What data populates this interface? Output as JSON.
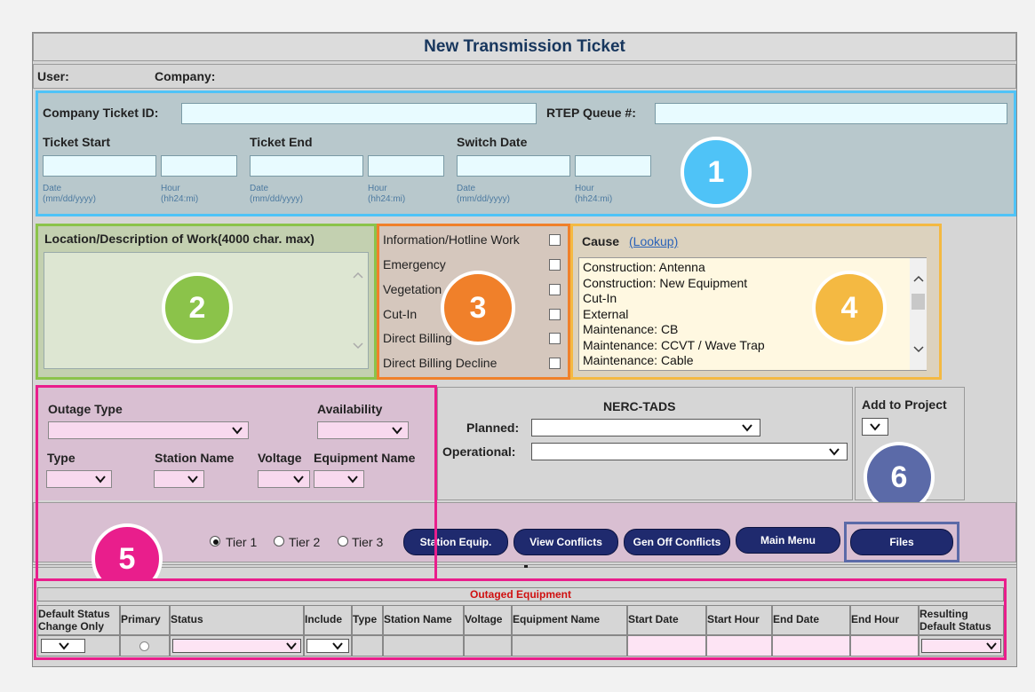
{
  "title": "New Transmission Ticket",
  "user_label": "User:",
  "company_label": "Company:",
  "company_ticket_label": "Company Ticket ID:",
  "rtep_label": "RTEP Queue #:",
  "ticket_start": "Ticket Start",
  "ticket_end": "Ticket End",
  "switch_date": "Switch Date",
  "date_hint1": "Date",
  "date_hint2": "(mm/dd/yyyy)",
  "hour_hint1": "Hour",
  "hour_hint2": "(hh24:mi)",
  "location_label": "Location/Description of Work(4000 char. max)",
  "checks": [
    "Information/Hotline Work",
    "Emergency",
    "Vegetation",
    "Cut-In",
    "Direct Billing",
    "Direct Billing Decline"
  ],
  "cause_label": "Cause",
  "cause_lookup": "(Lookup)",
  "cause_options": [
    "Construction: Antenna",
    "Construction: New Equipment",
    "Cut-In",
    "External",
    "Maintenance: CB",
    "Maintenance: CCVT / Wave Trap",
    "Maintenance: Cable"
  ],
  "outage_type": "Outage Type",
  "availability": "Availability",
  "type_label": "Type",
  "station_name": "Station Name",
  "voltage": "Voltage",
  "equipment_name": "Equipment Name",
  "nerc_title": "NERC-TADS",
  "planned": "Planned:",
  "operational": "Operational:",
  "add_to_project": "Add to Project",
  "tiers": [
    "Tier 1",
    "Tier 2",
    "Tier 3"
  ],
  "buttons": [
    "Station Equip.",
    "View Conflicts",
    "Gen Off Conflicts",
    "Main Menu",
    "Files"
  ],
  "outaged_title": "Outaged Equipment",
  "columns": [
    "Default Status Change Only",
    "Primary",
    "Status",
    "Include",
    "Type",
    "Station Name",
    "Voltage",
    "Equipment Name",
    "Start Date",
    "Start Hour",
    "End Date",
    "End Hour",
    "Resulting Default Status"
  ],
  "callouts": [
    "1",
    "2",
    "3",
    "4",
    "5",
    "6"
  ],
  "colors": {
    "c1": "#4fc3f7",
    "c2": "#8bc34a",
    "c3": "#f0802a",
    "c4": "#f4b942",
    "c5": "#e91e8c",
    "c6": "#5b6aa8"
  }
}
